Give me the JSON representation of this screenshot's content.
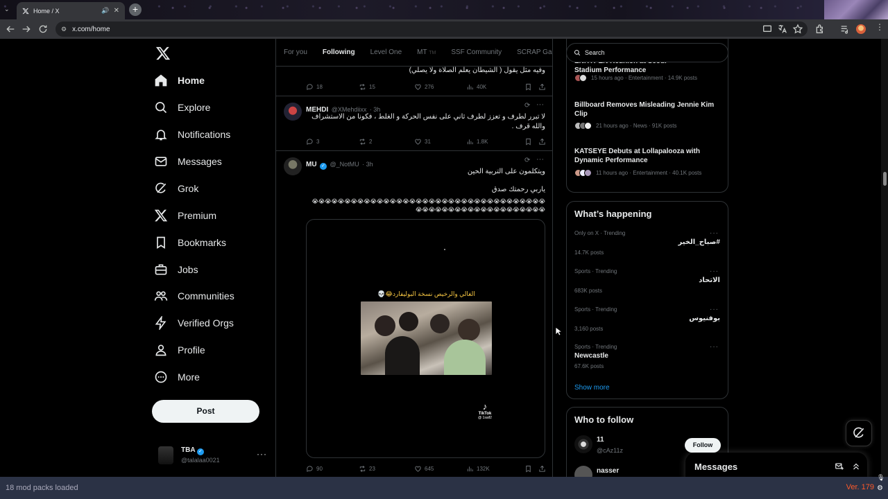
{
  "browser": {
    "tab_title": "Home / X",
    "url": "x.com/home"
  },
  "nav": {
    "items": [
      {
        "label": "Home",
        "icon": "home-icon"
      },
      {
        "label": "Explore",
        "icon": "search-icon"
      },
      {
        "label": "Notifications",
        "icon": "bell-icon"
      },
      {
        "label": "Messages",
        "icon": "envelope-icon"
      },
      {
        "label": "Grok",
        "icon": "grok-icon"
      },
      {
        "label": "Premium",
        "icon": "x-logo-icon"
      },
      {
        "label": "Bookmarks",
        "icon": "bookmark-icon"
      },
      {
        "label": "Jobs",
        "icon": "briefcase-icon"
      },
      {
        "label": "Communities",
        "icon": "people-icon"
      },
      {
        "label": "Verified Orgs",
        "icon": "lightning-icon"
      },
      {
        "label": "Profile",
        "icon": "person-icon"
      },
      {
        "label": "More",
        "icon": "more-circle-icon"
      }
    ],
    "post_label": "Post",
    "account": {
      "name": "TBA",
      "handle": "@talalaa0021"
    }
  },
  "feed": {
    "tabs": [
      "For you",
      "Following",
      "Level One",
      "MT",
      "SSF Community",
      "SCRAP Gang"
    ],
    "tab_badge": "TM",
    "prev_post": {
      "text": "وفيه مثل يقول ( الشيطان يعلم الصلاة ولا يصلي)",
      "replies": "18",
      "reposts": "15",
      "likes": "276",
      "views": "40K"
    },
    "posts": [
      {
        "name": "MEHDI",
        "handle": "@XMehdiixx",
        "time": "· 3h",
        "text": "لا تبرر لطرف و تعزز لطرف ثاني على نفس الحركة و الغلط ، فكونا من الاستشراف والله قرف .",
        "replies": "3",
        "reposts": "2",
        "likes": "31",
        "views": "1.8K"
      },
      {
        "name": "MU",
        "handle": "@_NotMU",
        "time": "· 3h",
        "line1": "ويتكلمون على التربية الحين",
        "line2": "ياربي رحمتك صدق",
        "line3": "😭😭😭😭😭😭😭😭😭😭😭😭😭😭😭😭😭😭😭😭😭😭😭😭😭😭😭😭😭😭😭😭😭😭😭😭😭😭😭😭😭😭😭😭😭😭😭😭😭😭😭😭😭😭😭😭",
        "video_caption": "الغالي والرخيص نسخة البوليفارد😂💀",
        "tiktok": "TikTok",
        "tiktok_handle": "@ 1saif2",
        "replies": "90",
        "reposts": "23",
        "likes": "645",
        "views": "132K"
      }
    ]
  },
  "right": {
    "search_placeholder": "Search",
    "news": [
      {
        "title": "ENHYPEN Reunion at Seoul Stadium Performance",
        "meta": "15 hours ago · Entertainment · 14.9K posts"
      },
      {
        "title": "Billboard Removes Misleading Jennie Kim Clip",
        "meta": "21 hours ago · News · 91K posts"
      },
      {
        "title": "KATSEYE Debuts at Lollapalooza with Dynamic Performance",
        "meta": "11 hours ago · Entertainment · 40.1K posts"
      }
    ],
    "happening_title": "What’s happening",
    "trends": [
      {
        "meta": "Only on X · Trending",
        "name": "#صباح_الخير",
        "posts": "14.7K posts",
        "rtl": true
      },
      {
        "meta": "Sports · Trending",
        "name": "الاتحاد",
        "posts": "683K posts",
        "rtl": true
      },
      {
        "meta": "Sports · Trending",
        "name": "بوفنيوس",
        "posts": "3,160 posts",
        "rtl": true
      },
      {
        "meta": "Sports · Trending",
        "name": "Newcastle",
        "posts": "67.6K posts",
        "rtl": false
      }
    ],
    "show_more": "Show more",
    "follow_title": "Who to follow",
    "follow": [
      {
        "name": "11",
        "handle": "@cAz11z",
        "button": "Follow"
      },
      {
        "name": "nasser",
        "handle": "",
        "button": ""
      }
    ],
    "messages_label": "Messages"
  },
  "status": {
    "left": "18 mod packs loaded",
    "version": "Ver. 179"
  },
  "colors": {
    "accent": "#1d9bf0",
    "bg": "#000000",
    "border": "#2f3336"
  }
}
